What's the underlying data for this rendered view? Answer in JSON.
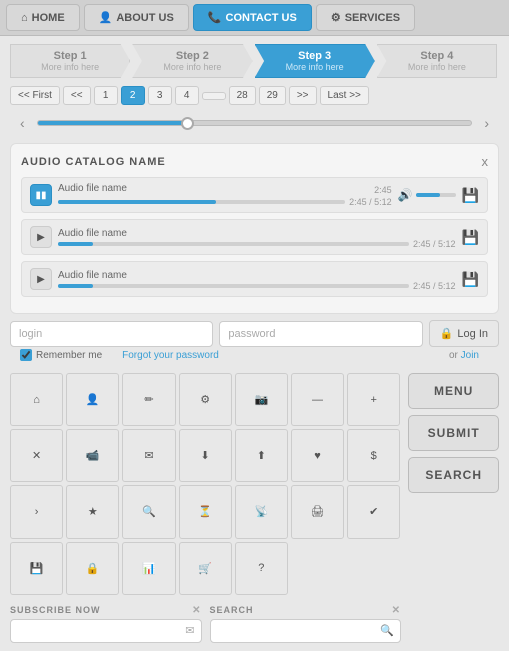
{
  "nav": {
    "items": [
      {
        "label": "HOME",
        "icon": "⌂",
        "active": false
      },
      {
        "label": "ABOUT US",
        "icon": "👤",
        "active": false
      },
      {
        "label": "CONTACT US",
        "icon": "📞",
        "active": true
      },
      {
        "label": "SERVICES",
        "icon": "⚙",
        "active": false
      }
    ]
  },
  "steps": {
    "items": [
      {
        "title": "Step 1",
        "sub": "More info here",
        "active": false
      },
      {
        "title": "Step 2",
        "sub": "More info here",
        "active": false
      },
      {
        "title": "Step 3",
        "sub": "More info here",
        "active": true
      },
      {
        "title": "Step 4",
        "sub": "More info here",
        "active": false
      }
    ]
  },
  "pagination": {
    "first": "<< First",
    "prev2": "<<",
    "pages": [
      "1",
      "2",
      "3",
      "4",
      "...",
      "28",
      "29"
    ],
    "active_page": "2",
    "next2": ">>",
    "last": "Last >>"
  },
  "audio_catalog": {
    "title": "AUDIO CATALOG NAME",
    "close": "x",
    "tracks": [
      {
        "name": "Audio file name",
        "time": "2:45",
        "total": "5:12",
        "playing": true,
        "fill_class": "playing"
      },
      {
        "name": "Audio file name",
        "time": "2:45",
        "total": "5:12",
        "playing": false,
        "fill_class": "paused1"
      },
      {
        "name": "Audio file name",
        "time": "2:45",
        "total": "5:12",
        "playing": false,
        "fill_class": "paused2"
      }
    ]
  },
  "login": {
    "login_placeholder": "login",
    "password_placeholder": "password",
    "login_btn": "Log In",
    "lock_icon": "🔒",
    "or_text": "or",
    "join_text": "Join",
    "remember_label": "Remember me",
    "forgot_text": "Forgot your password"
  },
  "icon_grid": {
    "icons": [
      "⌂",
      "👤",
      "✏",
      "⚙",
      "📷",
      "—",
      "+",
      "✕",
      "📹",
      "✉",
      "⬇",
      "⬆",
      "♥",
      "$",
      ">",
      "★",
      "🔍",
      "⏳",
      "?",
      "📡",
      "🖨",
      "✔",
      "💾",
      "🔒",
      "📊",
      "🛒",
      "❓",
      "…",
      "…",
      "…",
      "…",
      "…",
      "…",
      "…"
    ]
  },
  "right_buttons": {
    "menu": "MENU",
    "submit": "SUBMIT",
    "search": "SEARCH"
  },
  "bottom_inputs": {
    "subscribe_label": "SUBSCRIBE NOW",
    "subscribe_placeholder": "",
    "subscribe_icon": "✉",
    "search_label": "SEARCH",
    "search_placeholder": "",
    "search_icon": "🔍"
  }
}
